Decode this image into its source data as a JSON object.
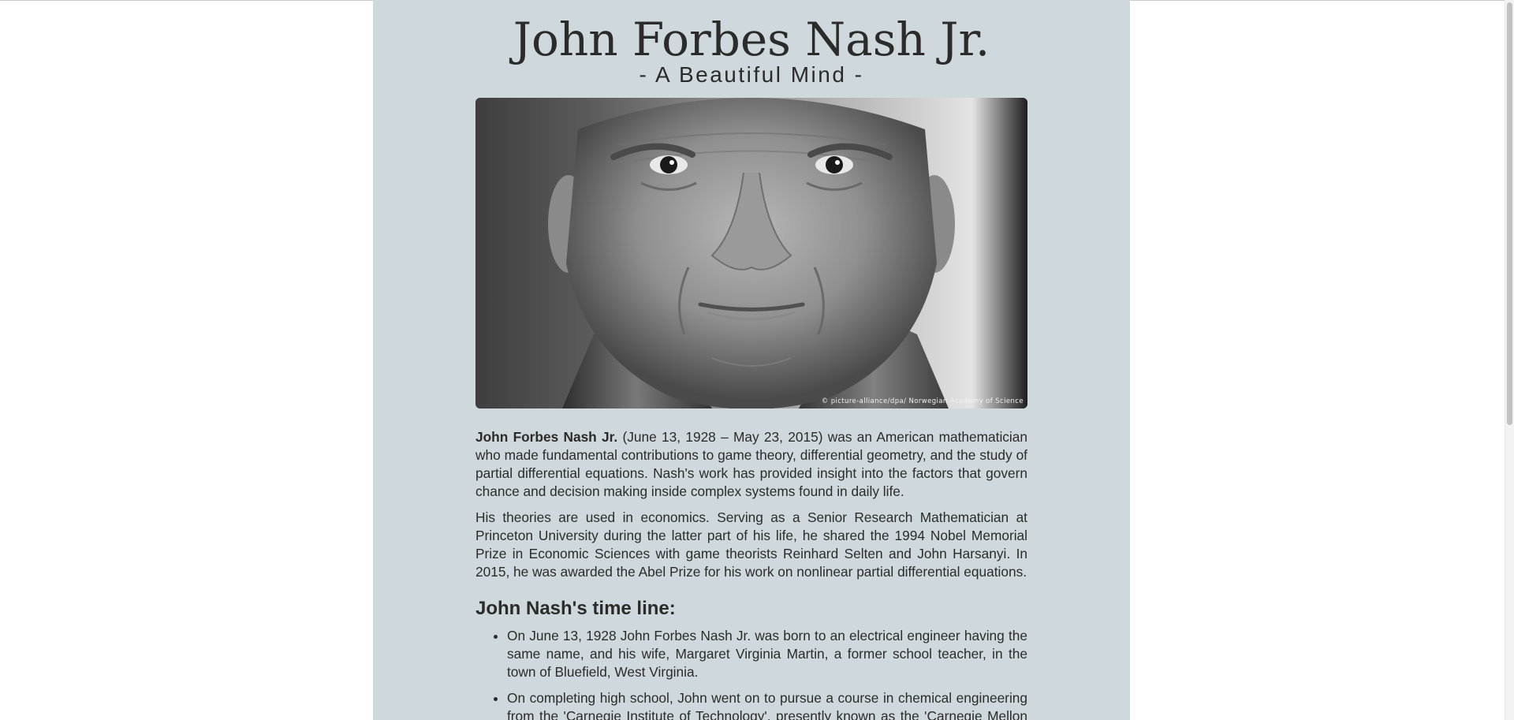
{
  "header": {
    "title": "John Forbes Nash Jr.",
    "subtitle": "- A Beautiful Mind -"
  },
  "photo": {
    "subject": "portrait photo of John Forbes Nash Jr.",
    "credit": "© picture-alliance/dpa/ Norwegian Academy of Science"
  },
  "intro": {
    "name_bold": "John Forbes Nash Jr.",
    "paragraph1_rest": " (June 13, 1928 – May 23, 2015) was an American mathematician who made fundamental contributions to game theory, differential geometry, and the study of partial differential equations. Nash's work has provided insight into the factors that govern chance and decision making inside complex systems found in daily life.",
    "paragraph2": "His theories are used in economics. Serving as a Senior Research Mathematician at Princeton University during the latter part of his life, he shared the 1994 Nobel Memorial Prize in Economic Sciences with game theorists Reinhard Selten and John Harsanyi. In 2015, he was awarded the Abel Prize for his work on nonlinear partial differential equations."
  },
  "timeline": {
    "heading": "John Nash's time line:",
    "items": [
      "On June 13, 1928 John Forbes Nash Jr. was born to an electrical engineer having the same name, and his wife, Margaret Virginia Martin, a former school teacher, in the town of Bluefield, West Virginia.",
      "On completing high school, John went on to pursue a course in chemical engineering from the 'Carnegie Institute of Technology', presently known as the 'Carnegie Mellon University'."
    ]
  },
  "colors": {
    "page_background": "#cfd8dc",
    "text": "#2b2b2b",
    "window_background": "#ffffff"
  }
}
